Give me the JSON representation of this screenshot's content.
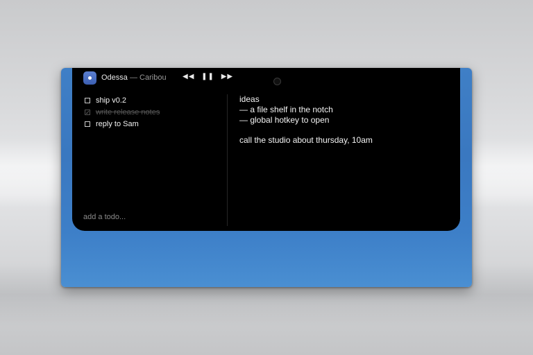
{
  "now_playing": {
    "track": "Odessa",
    "separator": " — ",
    "artist": "Caribou",
    "controls": {
      "previous": "◀◀",
      "pause": "❚❚",
      "next": "▶▶"
    }
  },
  "todos": {
    "items": [
      {
        "label": "ship v0.2",
        "done": false,
        "check": ""
      },
      {
        "label": "write release notes",
        "done": true,
        "check": "✓"
      },
      {
        "label": "reply to Sam",
        "done": false,
        "check": ""
      }
    ],
    "add_placeholder": "add a todo..."
  },
  "notes": {
    "lines": [
      "ideas",
      "— a file shelf in the notch",
      "— global hotkey to open",
      "call the studio about thursday, 10am"
    ]
  },
  "colors": {
    "notch": "#000000",
    "window": "#3d7fc8",
    "app_icon": "#4a6fc4"
  }
}
